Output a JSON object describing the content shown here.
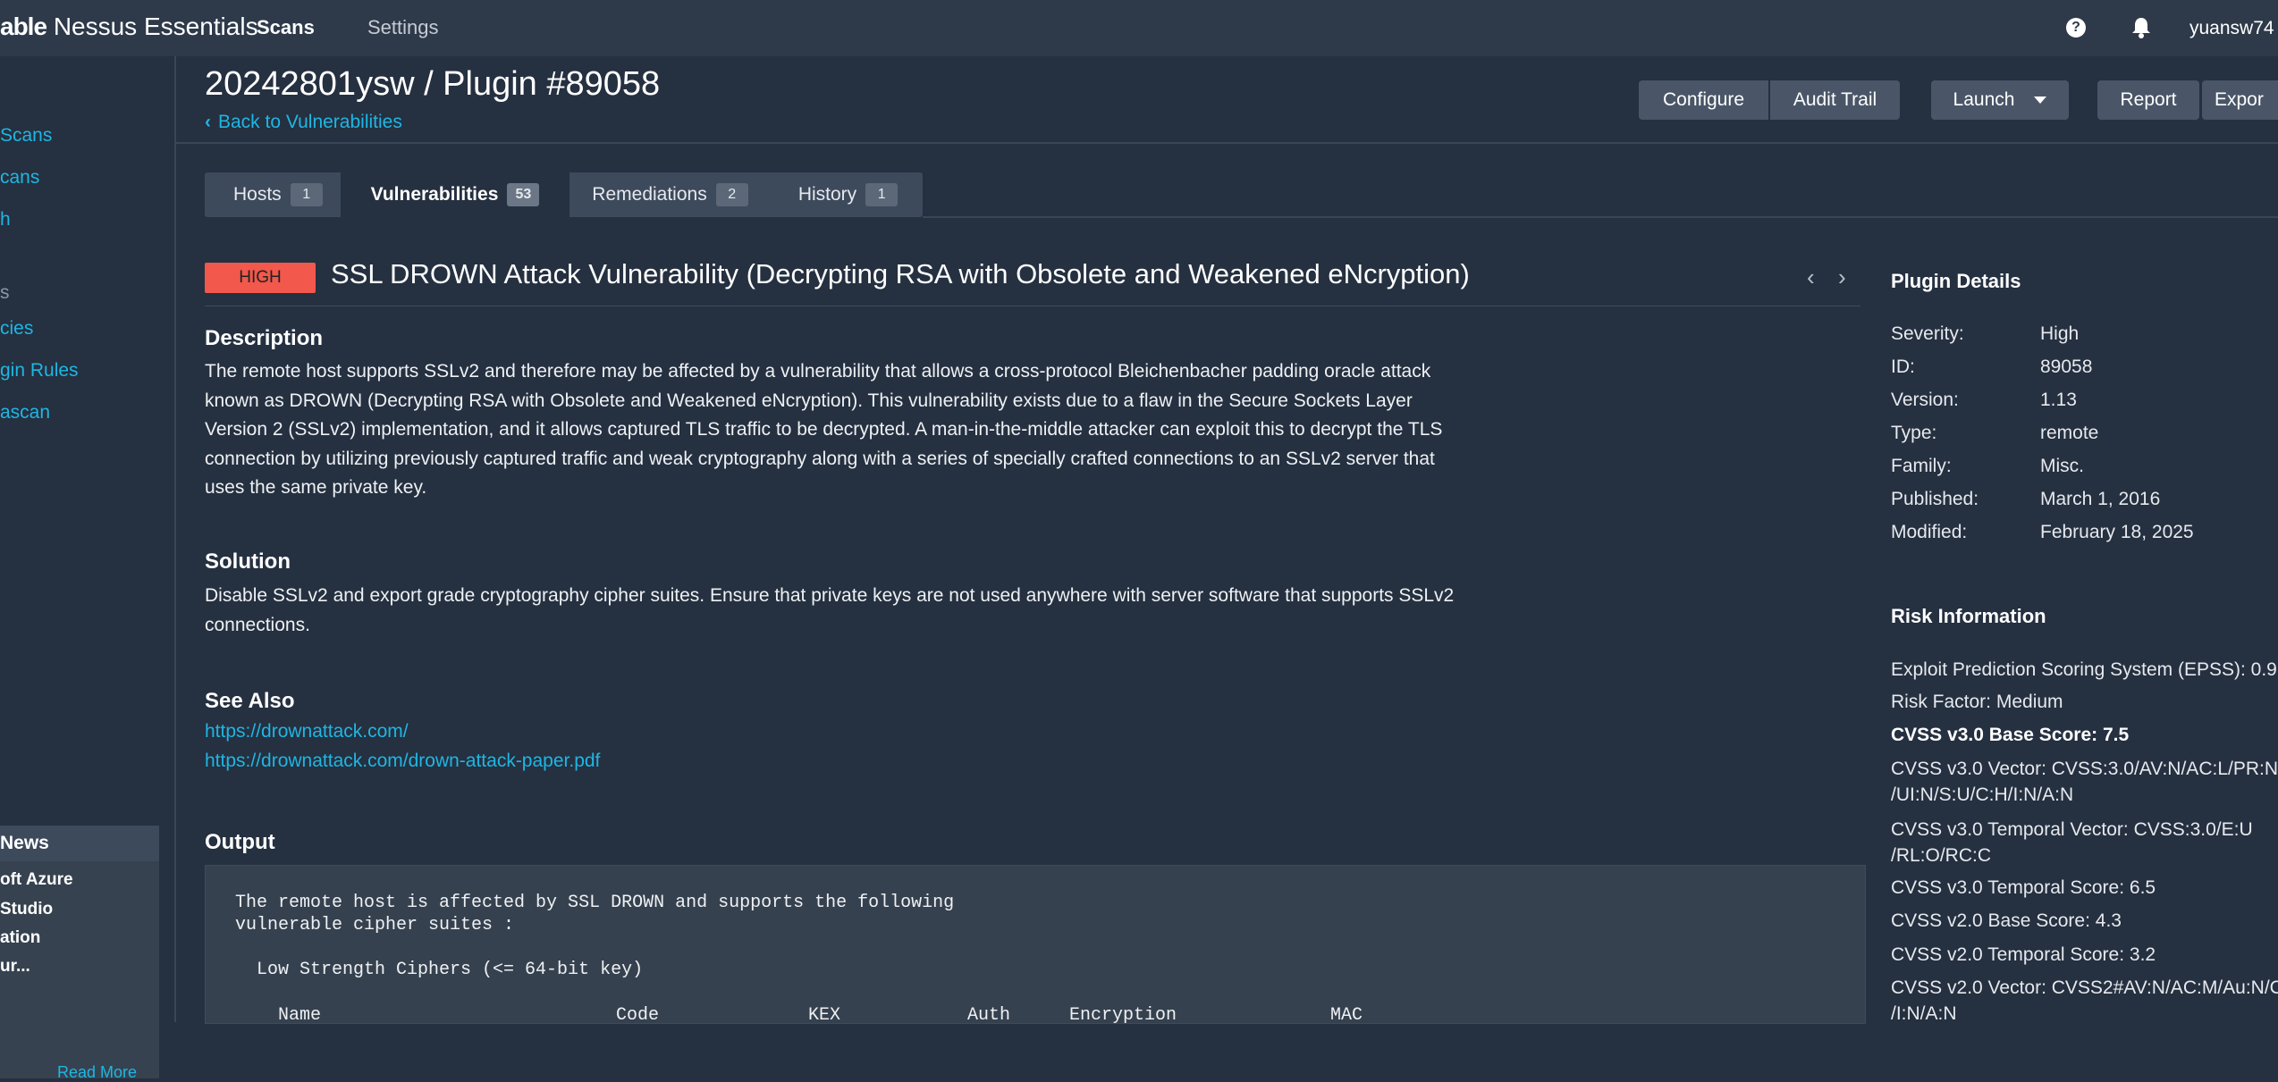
{
  "topbar": {
    "brand_prefix": "able",
    "brand_name": "Nessus Essentials",
    "nav_scans": "Scans",
    "nav_settings": "Settings",
    "help_glyph": "?",
    "username": "yuansw74"
  },
  "sidebar": {
    "links": [
      "Scans",
      "cans",
      "h",
      "s",
      "cies",
      "gin Rules",
      "ascan"
    ],
    "news_title": "News",
    "news_lines": [
      "oft Azure",
      "Studio",
      "ation",
      "ur..."
    ],
    "news_more": "Read More"
  },
  "header": {
    "title": "20242801ysw / Plugin #89058",
    "back_label": "Back to Vulnerabilities",
    "buttons": {
      "configure": "Configure",
      "audit_trail": "Audit Trail",
      "launch": "Launch",
      "report": "Report",
      "export": "Expor"
    }
  },
  "tabs": [
    {
      "label": "Hosts",
      "count": "1"
    },
    {
      "label": "Vulnerabilities",
      "count": "53"
    },
    {
      "label": "Remediations",
      "count": "2"
    },
    {
      "label": "History",
      "count": "1"
    }
  ],
  "vuln": {
    "severity": "HIGH",
    "title": "SSL DROWN Attack Vulnerability (Decrypting RSA with Obsolete and Weakened eNcryption)",
    "prev_glyph": "‹",
    "next_glyph": "›",
    "description_heading": "Description",
    "description_lines": [
      "The remote host supports SSLv2 and therefore may be affected by a vulnerability that allows a cross-protocol Bleichenbacher padding oracle attack",
      "known as DROWN (Decrypting RSA with Obsolete and Weakened eNcryption). This vulnerability exists due to a flaw in the Secure Sockets Layer",
      "Version 2 (SSLv2) implementation, and it allows captured TLS traffic to be decrypted. A man-in-the-middle attacker can exploit this to decrypt the TLS",
      "connection by utilizing previously captured traffic and weak cryptography along with a series of specially crafted connections to an SSLv2 server that",
      "uses the same private key."
    ],
    "solution_heading": "Solution",
    "solution_lines": [
      "Disable SSLv2 and export grade cryptography cipher suites. Ensure that private keys are not used anywhere with server software that supports SSLv2",
      "connections."
    ],
    "see_also_heading": "See Also",
    "see_also_links": [
      "https://drownattack.com/",
      "https://drownattack.com/drown-attack-paper.pdf"
    ],
    "output_heading": "Output",
    "output_lines": [
      "The remote host is affected by SSL DROWN and supports the following",
      "vulnerable cipher suites :",
      "Low Strength Ciphers (<= 64-bit key)",
      "Name",
      "Code",
      "KEX",
      "Auth",
      "Encryption",
      "MAC"
    ]
  },
  "plugin_details": {
    "heading": "Plugin Details",
    "rows": [
      {
        "label": "Severity:",
        "value": "High"
      },
      {
        "label": "ID:",
        "value": "89058"
      },
      {
        "label": "Version:",
        "value": "1.13"
      },
      {
        "label": "Type:",
        "value": "remote"
      },
      {
        "label": "Family:",
        "value": "Misc."
      },
      {
        "label": "Published:",
        "value": "March 1, 2016"
      },
      {
        "label": "Modified:",
        "value": "February 18, 2025"
      }
    ]
  },
  "risk_information": {
    "heading": "Risk Information",
    "lines": [
      "Exploit Prediction Scoring System (EPSS): 0.9",
      "Risk Factor: Medium",
      "CVSS v3.0 Base Score: 7.5",
      "CVSS v3.0 Vector: CVSS:3.0/AV:N/AC:L/PR:N",
      "/UI:N/S:U/C:H/I:N/A:N",
      "CVSS v3.0 Temporal Vector: CVSS:3.0/E:U",
      "/RL:O/RC:C",
      "CVSS v3.0 Temporal Score: 6.5",
      "CVSS v2.0 Base Score: 4.3",
      "CVSS v2.0 Temporal Score: 3.2",
      "CVSS v2.0 Vector: CVSS2#AV:N/AC:M/Au:N/C",
      "/I:N/A:N"
    ]
  }
}
